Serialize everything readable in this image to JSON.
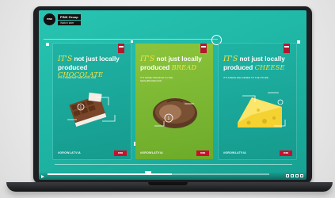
{
  "channel": {
    "logo_text": "PINK",
    "name": "PINK Group",
    "subtitle": "Watch later"
  },
  "posters": [
    {
      "prefix": "IT'S",
      "line1": " not just locally",
      "line2": "produced ",
      "product": "CHOCOLATE",
      "tagline": "IT'S A SWEETER TIME IN ALL AGE",
      "hashtag": "#GROWLATVIA",
      "brand": "RIMI",
      "background": "#1fb3a4",
      "art_icon": "chocolate-icon"
    },
    {
      "prefix": "IT'S",
      "line1": " not just locally",
      "line2": "produced ",
      "product": "BREAD",
      "tagline": "IT'S MADE STRAIGHT IN THE NEIGHBOURHOOD",
      "hashtag": "#GROWLATVIA",
      "brand": "RIMI",
      "background": "#8cc43c",
      "art_icon": "bread-icon"
    },
    {
      "prefix": "IT'S",
      "line1": " not just locally",
      "line2": "produced ",
      "product": "CHEESE",
      "tagline": "IT'S FRESH DELIVERED TO THE STORE",
      "hashtag": "#GROWLATVIA",
      "brand": "RIMI",
      "background": "#1fb3a4",
      "art_icon": "cheese-icon"
    }
  ],
  "player": {
    "progress": 0.56,
    "accent": "#ffffff"
  }
}
